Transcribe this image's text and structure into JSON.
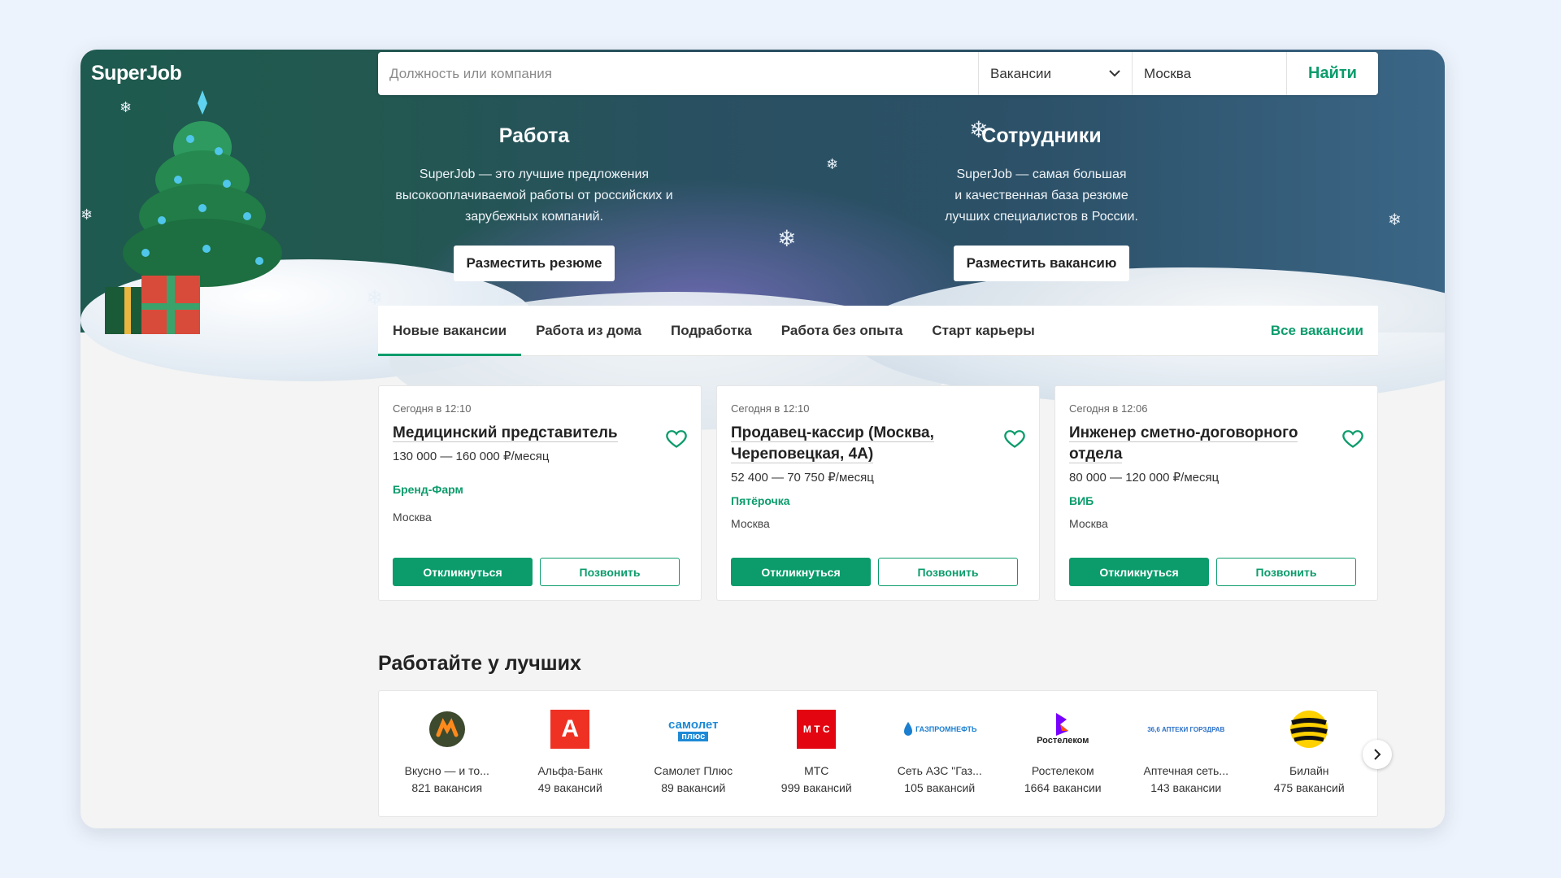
{
  "brand": {
    "logo_text": "SuperJob",
    "accent": "#0c9c6c"
  },
  "search": {
    "placeholder": "Должность или компания",
    "type_selected": "Вакансии",
    "city_value": "Москва",
    "submit_label": "Найти"
  },
  "promo": {
    "work": {
      "title": "Работа",
      "text": [
        "SuperJob — это лучшие предложения",
        "высокооплачиваемой работы от российских и",
        "зарубежных компаний."
      ],
      "button": "Разместить резюме"
    },
    "employees": {
      "title": "Сотрудники",
      "text": [
        "SuperJob — самая большая",
        "и качественная база резюме",
        "лучших специалистов в России."
      ],
      "button": "Разместить вакансию"
    }
  },
  "tabs": [
    {
      "label": "Новые вакансии",
      "active": true
    },
    {
      "label": "Работа из дома",
      "active": false
    },
    {
      "label": "Подработка",
      "active": false
    },
    {
      "label": "Работа без опыта",
      "active": false
    },
    {
      "label": "Старт карьеры",
      "active": false
    }
  ],
  "tabs_all": "Все вакансии",
  "vacancies": [
    {
      "time": "Сегодня в 12:10",
      "title": "Медицинский представитель",
      "salary": "130 000 — 160 000 ₽/месяц",
      "company": "Бренд-Фарм",
      "location": "Москва",
      "apply": "Откликнуться",
      "call": "Позвонить"
    },
    {
      "time": "Сегодня в 12:10",
      "title": "Продавец-кассир (Москва, Череповецкая, 4А)",
      "salary": "52 400 — 70 750 ₽/месяц",
      "company": "Пятёрочка",
      "location": "Москва",
      "apply": "Откликнуться",
      "call": "Позвонить"
    },
    {
      "time": "Сегодня в 12:06",
      "title": "Инженер сметно-договорного отдела",
      "salary": "80 000 — 120 000 ₽/месяц",
      "company": "ВИБ",
      "location": "Москва",
      "apply": "Откликнуться",
      "call": "Позвонить"
    }
  ],
  "best": {
    "title": "Работайте у лучших",
    "employers": [
      {
        "name": "Вкусно — и то...",
        "count": "821 вакансия",
        "icon": "vkusno-logo"
      },
      {
        "name": "Альфа-Банк",
        "count": "49 вакансий",
        "icon": "alfa-logo",
        "logo_text": "А"
      },
      {
        "name": "Самолет Плюс",
        "count": "89 вакансий",
        "icon": "samolet-logo",
        "logo_text": "самолет",
        "logo_sub": "плюс"
      },
      {
        "name": "МТС",
        "count": "999 вакансий",
        "icon": "mts-logo",
        "logo_text": "М Т С"
      },
      {
        "name": "Сеть АЗС \"Газ...",
        "count": "105 вакансий",
        "icon": "gazprom-logo",
        "logo_text": "ГАЗПРОМНЕФТЬ"
      },
      {
        "name": "Ростелеком",
        "count": "1664 вакансии",
        "icon": "rostelecom-logo",
        "logo_text": "Ростелеком"
      },
      {
        "name": "Аптечная сеть...",
        "count": "143 вакансии",
        "icon": "apteka-logo",
        "logo_text": "36,6 АПТЕКИ ГОРЗДРАВ"
      },
      {
        "name": "Билайн",
        "count": "475 вакансий",
        "icon": "beeline-logo"
      }
    ]
  }
}
